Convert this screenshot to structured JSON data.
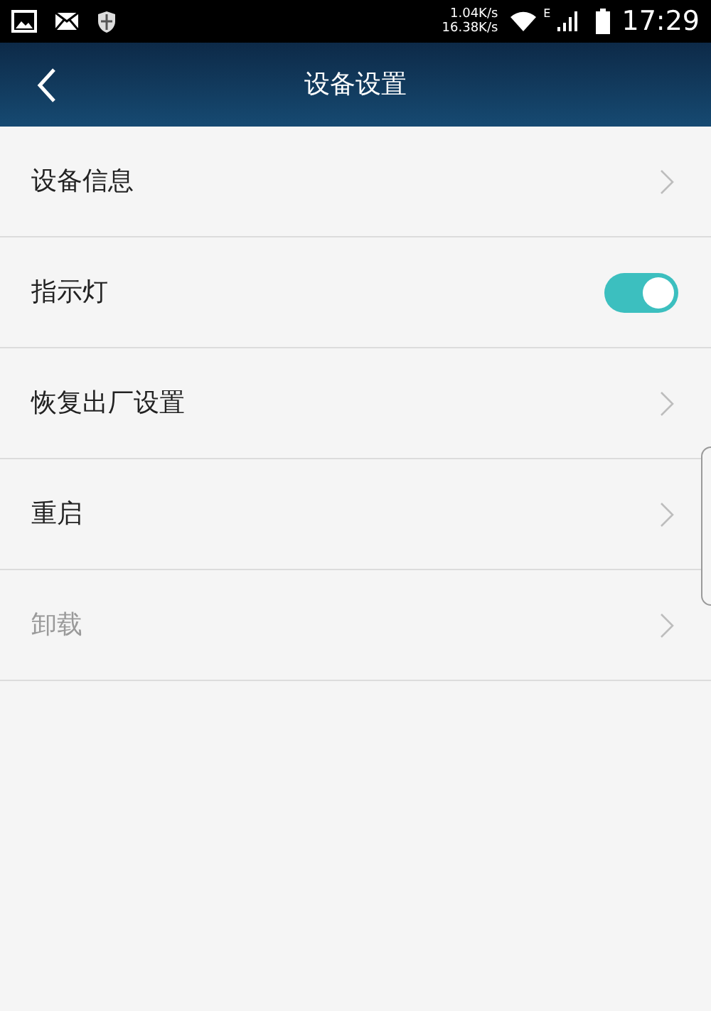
{
  "status_bar": {
    "upload_speed": "1.04K/s",
    "download_speed": "16.38K/s",
    "network_type": "E",
    "time": "17:29"
  },
  "header": {
    "title": "设备设置"
  },
  "items": [
    {
      "kind": "link",
      "label": "设备信息",
      "disabled": false
    },
    {
      "kind": "toggle",
      "label": "指示灯",
      "on": true
    },
    {
      "kind": "link",
      "label": "恢复出厂设置",
      "disabled": false
    },
    {
      "kind": "link",
      "label": "重启",
      "disabled": false
    },
    {
      "kind": "link",
      "label": "卸载",
      "disabled": true
    }
  ]
}
